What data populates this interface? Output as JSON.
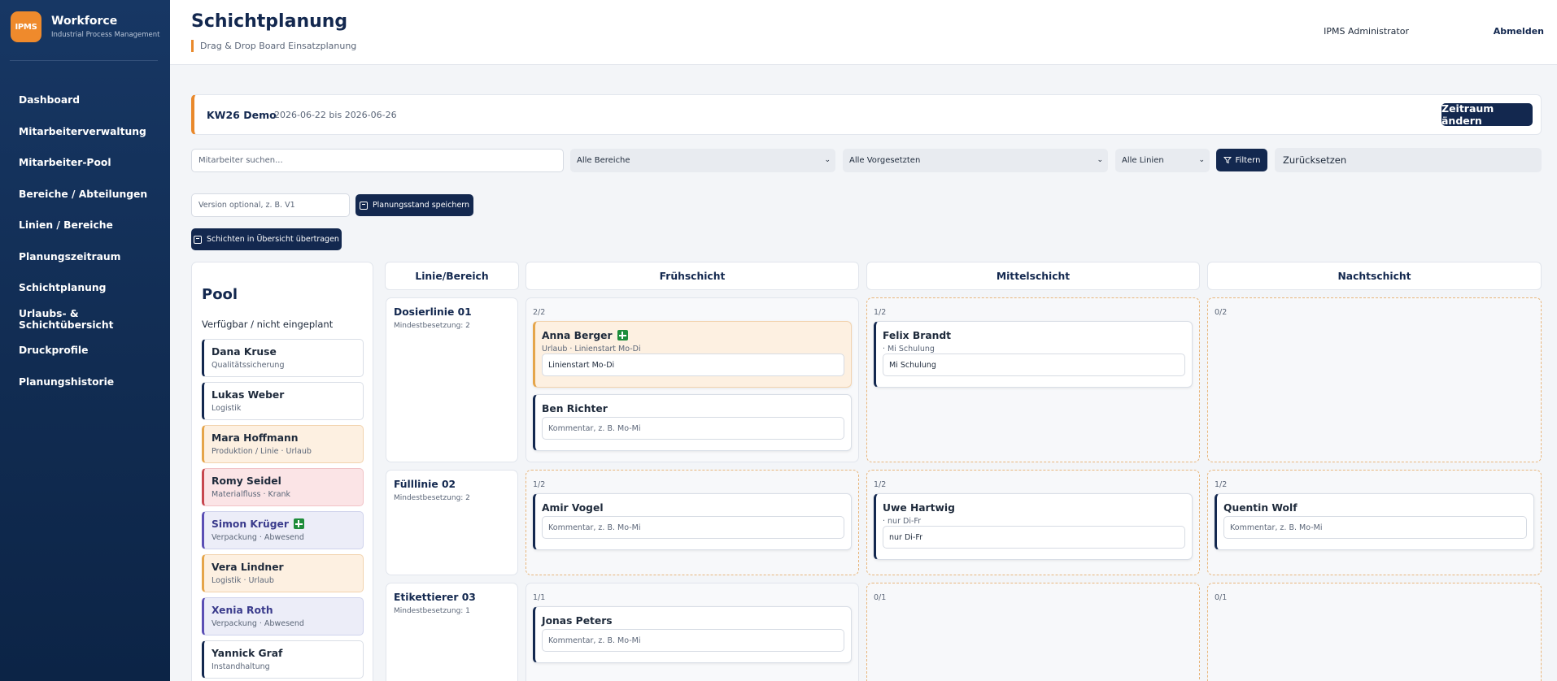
{
  "brand": {
    "logo": "IPMS",
    "name": "Workforce",
    "sub": "Industrial Process Management"
  },
  "nav": [
    "Dashboard",
    "Mitarbeiterverwaltung",
    "Mitarbeiter-Pool",
    "Bereiche / Abteilungen",
    "Linien / Bereiche",
    "Planungszeitraum",
    "Schichtplanung",
    "Urlaubs- & Schichtübersicht",
    "Druckprofile",
    "Planungshistorie"
  ],
  "header": {
    "title": "Schichtplanung",
    "subtitle": "Drag & Drop Board Einsatzplanung",
    "user": "IPMS Administrator",
    "logout": "Abmelden"
  },
  "period": {
    "name": "KW26 Demo",
    "range": "2026-06-22 bis 2026-06-26",
    "button": "Zeitraum ändern"
  },
  "filters": {
    "search_placeholder": "Mitarbeiter suchen...",
    "area": "Alle Bereiche",
    "supervisor": "Alle Vorgesetzten",
    "lines": "Alle Linien",
    "filter_button": "Filtern",
    "reset_button": "Zurücksetzen"
  },
  "actions": {
    "version_placeholder": "Version optional, z. B. V1",
    "save_button": "Planungsstand speichern",
    "transfer_button": "Schichten in Übersicht übertragen"
  },
  "pool": {
    "title": "Pool",
    "subtitle": "Verfügbar / nicht eingeplant",
    "items": [
      {
        "name": "Dana Kruse",
        "sub": "Qualitätssicherung"
      },
      {
        "name": "Lukas Weber",
        "sub": "Logistik"
      },
      {
        "name": "Mara Hoffmann",
        "sub": "Produktion / Linie · Urlaub"
      },
      {
        "name": "Romy Seidel",
        "sub": "Materialfluss · Krank"
      },
      {
        "name": "Simon Krüger",
        "sub": "Verpackung · Abwesend"
      },
      {
        "name": "Vera Lindner",
        "sub": "Logistik · Urlaub"
      },
      {
        "name": "Xenia Roth",
        "sub": "Verpackung · Abwesend"
      },
      {
        "name": "Yannick Graf",
        "sub": "Instandhaltung"
      }
    ]
  },
  "board": {
    "headers": [
      "Linie/Bereich",
      "Frühschicht",
      "Mittelschicht",
      "Nachtschicht"
    ],
    "lines": [
      {
        "name": "Dosierlinie 01",
        "min": "Mindestbesetzung: 2"
      },
      {
        "name": "Fülllinie 02",
        "min": "Mindestbesetzung: 2"
      },
      {
        "name": "Etikettierer 03",
        "min": "Mindestbesetzung: 1"
      }
    ],
    "counts": {
      "r1": [
        "2/2",
        "1/2",
        "0/2"
      ],
      "r2": [
        "1/2",
        "1/2",
        "1/2"
      ],
      "r3": [
        "1/1",
        "0/1",
        "0/1"
      ]
    },
    "comment_placeholder": "Kommentar, z. B. Mo-Mi",
    "cards": {
      "anna": {
        "name": "Anna Berger",
        "sub": "Urlaub · Linienstart Mo-Di",
        "comment": "Linienstart Mo-Di"
      },
      "ben": {
        "name": "Ben Richter"
      },
      "felix": {
        "name": "Felix Brandt",
        "sub": "· Mi Schulung",
        "comment": "Mi Schulung"
      },
      "amir": {
        "name": "Amir Vogel"
      },
      "uwe": {
        "name": "Uwe Hartwig",
        "sub": "· nur Di-Fr",
        "comment": "nur Di-Fr"
      },
      "quentin": {
        "name": "Quentin Wolf"
      },
      "jonas": {
        "name": "Jonas Peters"
      }
    }
  }
}
